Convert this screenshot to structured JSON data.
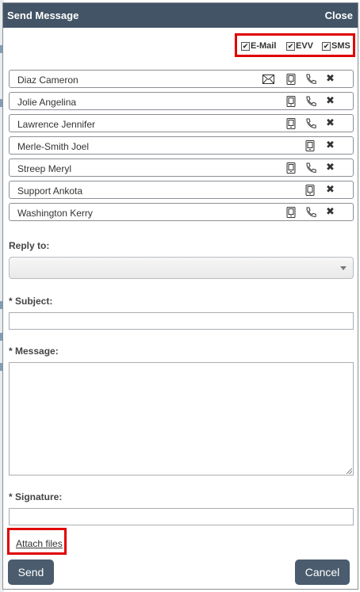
{
  "dialog": {
    "title": "Send Message",
    "close_label": "Close"
  },
  "channels": [
    {
      "label": "E-Mail",
      "checked": true
    },
    {
      "label": "EVV",
      "checked": true
    },
    {
      "label": "SMS",
      "checked": true
    }
  ],
  "recipients": [
    {
      "name": "Diaz Cameron",
      "icons": [
        "email-icon",
        "mobile-phone-icon",
        "phone-icon"
      ]
    },
    {
      "name": "Jolie Angelina",
      "icons": [
        "mobile-phone-icon",
        "phone-icon"
      ]
    },
    {
      "name": "Lawrence Jennifer",
      "icons": [
        "mobile-phone-icon",
        "phone-icon"
      ]
    },
    {
      "name": "Merle-Smith Joel",
      "icons": [
        "mobile-phone-icon"
      ]
    },
    {
      "name": "Streep Meryl",
      "icons": [
        "mobile-phone-icon",
        "phone-icon"
      ]
    },
    {
      "name": "Support Ankota",
      "icons": [
        "mobile-phone-icon"
      ]
    },
    {
      "name": "Washington Kerry",
      "icons": [
        "mobile-phone-icon",
        "phone-icon"
      ]
    }
  ],
  "remove_symbol": "✖",
  "form": {
    "reply_to_label": "Reply to:",
    "reply_to_value": "",
    "subject_label": "* Subject:",
    "subject_value": "",
    "message_label": "* Message:",
    "message_value": "",
    "signature_label": "* Signature:",
    "signature_value": ""
  },
  "attach_files_label": "Attach files",
  "buttons": {
    "send_label": "Send",
    "cancel_label": "Cancel"
  },
  "colors": {
    "title_bar": "#435466",
    "button": "#4a5c6d",
    "highlight": "#e00000"
  }
}
